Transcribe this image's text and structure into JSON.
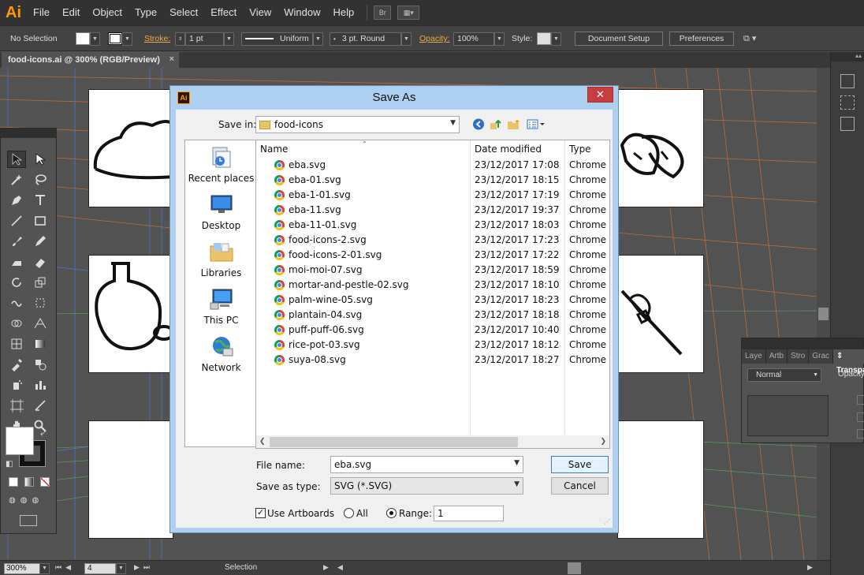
{
  "app": {
    "logo": "Ai",
    "menu": [
      "File",
      "Edit",
      "Object",
      "Type",
      "Select",
      "Effect",
      "View",
      "Window",
      "Help"
    ],
    "bridge_button": "Br"
  },
  "control_bar": {
    "selection_status": "No Selection",
    "stroke_label": "Stroke:",
    "stroke_weight": "1 pt",
    "profile": "Uniform",
    "brush": "3 pt. Round",
    "opacity_label": "Opacity:",
    "opacity_value": "100%",
    "style_label": "Style:",
    "document_setup": "Document Setup",
    "preferences": "Preferences"
  },
  "document_tab": {
    "title": "food-icons.ai @ 300% (RGB/Preview)",
    "close": "×"
  },
  "status_bar": {
    "zoom": "300%",
    "artboard_number": "4",
    "status_text": "Selection"
  },
  "transparency_panel": {
    "tabs": [
      "Laye",
      "Artb",
      "Stro",
      "Grac",
      "Transpa"
    ],
    "blend_mode": "Normal",
    "opacity_label": "Opacity"
  },
  "dialog": {
    "title": "Save As",
    "close": "✕",
    "save_in_label": "Save in:",
    "save_in_value": "food-icons",
    "places": [
      "Recent places",
      "Desktop",
      "Libraries",
      "This PC",
      "Network"
    ],
    "columns": [
      "Name",
      "Date modified",
      "Type"
    ],
    "files": [
      {
        "name": "eba.svg",
        "date": "23/12/2017 17:08",
        "type": "Chrome H"
      },
      {
        "name": "eba-01.svg",
        "date": "23/12/2017 18:15",
        "type": "Chrome H"
      },
      {
        "name": "eba-1-01.svg",
        "date": "23/12/2017 17:19",
        "type": "Chrome H"
      },
      {
        "name": "eba-11.svg",
        "date": "23/12/2017 19:37",
        "type": "Chrome H"
      },
      {
        "name": "eba-11-01.svg",
        "date": "23/12/2017 18:03",
        "type": "Chrome H"
      },
      {
        "name": "food-icons-2.svg",
        "date": "23/12/2017 17:23",
        "type": "Chrome H"
      },
      {
        "name": "food-icons-2-01.svg",
        "date": "23/12/2017 17:22",
        "type": "Chrome H"
      },
      {
        "name": "moi-moi-07.svg",
        "date": "23/12/2017 18:59",
        "type": "Chrome H"
      },
      {
        "name": "mortar-and-pestle-02.svg",
        "date": "23/12/2017 18:10",
        "type": "Chrome H"
      },
      {
        "name": "palm-wine-05.svg",
        "date": "23/12/2017 18:23",
        "type": "Chrome H"
      },
      {
        "name": "plantain-04.svg",
        "date": "23/12/2017 18:18",
        "type": "Chrome H"
      },
      {
        "name": "puff-puff-06.svg",
        "date": "23/12/2017 10:40",
        "type": "Chrome H"
      },
      {
        "name": "rice-pot-03.svg",
        "date": "23/12/2017 18:12",
        "type": "Chrome H"
      },
      {
        "name": "suya-08.svg",
        "date": "23/12/2017 18:27",
        "type": "Chrome H"
      }
    ],
    "file_name_label": "File name:",
    "file_name_value": "eba.svg",
    "save_type_label": "Save as type:",
    "save_type_value": "SVG (*.SVG)",
    "save_button": "Save",
    "cancel_button": "Cancel",
    "use_artboards_label": "Use Artboards",
    "all_label": "All",
    "range_label": "Range:",
    "range_value": "1"
  }
}
